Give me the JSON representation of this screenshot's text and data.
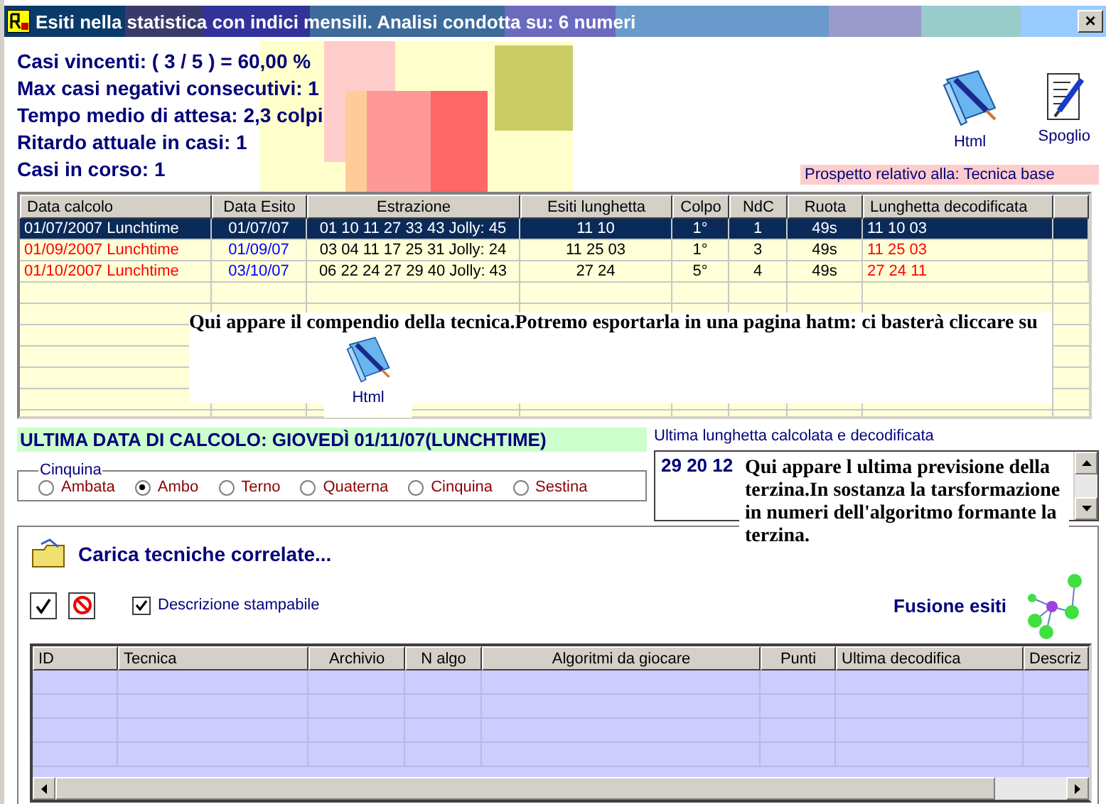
{
  "window": {
    "title": "Esiti nella statistica con indici mensili. Analisi condotta su: 6 numeri",
    "close": "×"
  },
  "stats": [
    "Casi vincenti: ( 3 / 5 ) = 60,00 %",
    "Max casi negativi consecutivi: 1",
    "Tempo medio di attesa: 2,3 colpi",
    "Ritardo attuale in casi: 1",
    "Casi in corso: 1"
  ],
  "tools": [
    {
      "kind": "book",
      "label": "Html"
    },
    {
      "kind": "scroll",
      "label": "Spoglio"
    }
  ],
  "prospetto": "Prospetto relativo alla: Tecnica base",
  "table": {
    "columns": [
      "Data calcolo",
      "Data Esito",
      "Estrazione",
      "Esiti lunghetta",
      "Colpo",
      "NdC",
      "Ruota",
      "Lunghetta decodificata"
    ],
    "rows": [
      {
        "selected": true,
        "hit": false,
        "cells": [
          "01/07/2007 Lunchtime",
          "01/07/07",
          "01 10 11 27 33 43 Jolly: 45",
          "11 10",
          "1°",
          "1",
          "49s",
          "11 10 03"
        ]
      },
      {
        "selected": false,
        "hit": true,
        "cells": [
          "01/09/2007 Lunchtime",
          "01/09/07",
          "03 04 11 17 25 31 Jolly: 24",
          "11 25 03",
          "1°",
          "3",
          "49s",
          "11 25 03"
        ]
      },
      {
        "selected": false,
        "hit": true,
        "cells": [
          "01/10/2007 Lunchtime",
          "03/10/07",
          "06 22 24 27 29 40 Jolly: 43",
          "27 24",
          "5°",
          "4",
          "49s",
          "27 24 11"
        ]
      }
    ]
  },
  "callouts": [
    {
      "text": "Qui appare il compendio della tecnica.Potremo esportarla in una pagina hatm: ci basterà cliccare su",
      "icon_label": "Html"
    },
    {
      "text": "Qui appare l ultima previsione della terzina.In sostanza la tarsformazione in numeri dell'algoritmo formante la terzina."
    }
  ],
  "ultima_data": "ULTIMA DATA DI CALCOLO: GIOVEDÌ 01/11/07(LUNCHTIME)",
  "sorte": {
    "legend": "Cinquina",
    "options": [
      {
        "label": "Ambata",
        "selected": false
      },
      {
        "label": "Ambo",
        "selected": true
      },
      {
        "label": "Terno",
        "selected": false
      },
      {
        "label": "Quaterna",
        "selected": false
      },
      {
        "label": "Cinquina",
        "selected": false
      },
      {
        "label": "Sestina",
        "selected": false
      }
    ]
  },
  "ultima_lunghetta": {
    "label": "Ultima lunghetta calcolata e decodificata",
    "value": "29 20 12"
  },
  "correlate": {
    "title": "Carica tecniche correlate...",
    "checkbox": {
      "label": "Descrizione stampabile",
      "checked": true
    },
    "fusione": "Fusione esiti",
    "columns": [
      "ID",
      "Tecnica",
      "Archivio",
      "N algo",
      "Algoritmi da giocare",
      "Punti",
      "Ultima decodifica",
      "Descriz"
    ]
  }
}
